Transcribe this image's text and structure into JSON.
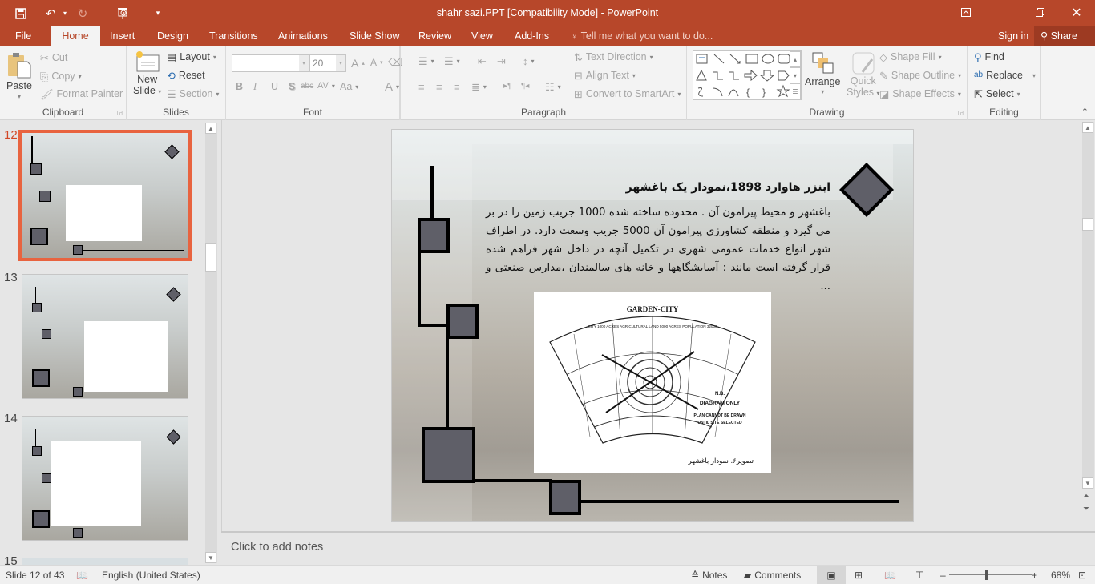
{
  "app": {
    "window_title": "shahr sazi.PPT [Compatibility Mode] - PowerPoint",
    "quick_access": [
      "save-icon",
      "undo-icon",
      "redo-icon",
      "start-from-beginning-icon",
      "customize-qat-icon"
    ],
    "window_controls": [
      "ribbon-display-options-icon",
      "minimize-icon",
      "restore-icon",
      "close-icon"
    ]
  },
  "tabs": [
    {
      "label": "File"
    },
    {
      "label": "Home",
      "active": true
    },
    {
      "label": "Insert"
    },
    {
      "label": "Design"
    },
    {
      "label": "Transitions"
    },
    {
      "label": "Animations"
    },
    {
      "label": "Slide Show"
    },
    {
      "label": "Review"
    },
    {
      "label": "View"
    },
    {
      "label": "Add-Ins"
    }
  ],
  "tell_me": "Tell me what you want to do...",
  "sign_in": "Sign in",
  "share": "Share",
  "ribbon": {
    "clipboard": {
      "label": "Clipboard",
      "paste": "Paste",
      "cut": "Cut",
      "copy": "Copy",
      "format_painter": "Format Painter"
    },
    "slides": {
      "label": "Slides",
      "new_slide_1": "New",
      "new_slide_2": "Slide",
      "layout": "Layout",
      "reset": "Reset",
      "section": "Section"
    },
    "font": {
      "label": "Font",
      "font_name": "",
      "font_size": "20",
      "bold": "B",
      "italic": "I",
      "underline": "U",
      "shadow": "S",
      "strike": "abc",
      "spacing": "AV",
      "case": "Aa",
      "color": "A",
      "grow": "A",
      "shrink": "A"
    },
    "paragraph": {
      "label": "Paragraph",
      "text_direction": "Text Direction",
      "align_text": "Align Text",
      "smartart": "Convert to SmartArt"
    },
    "drawing": {
      "label": "Drawing",
      "arrange": "Arrange",
      "quick_styles_1": "Quick",
      "quick_styles_2": "Styles",
      "shape_fill": "Shape Fill",
      "shape_outline": "Shape Outline",
      "shape_effects": "Shape Effects"
    },
    "editing": {
      "label": "Editing",
      "find": "Find",
      "replace": "Replace",
      "select": "Select"
    }
  },
  "thumbnails": [
    {
      "number": "12",
      "selected": true
    },
    {
      "number": "13",
      "selected": false
    },
    {
      "number": "14",
      "selected": false
    },
    {
      "number": "15",
      "selected": false
    }
  ],
  "slide": {
    "title": "ابنزر هاوارد 1898،نمودار یک  باغشهر",
    "body": "باغشهر و محیط پیرامون آن . محدوده ساخته شده 1000 جریب زمین را در بر می گیرد و منطقه کشاورزی پیرامون آن 5000 جریب وسعت دارد. در اطراف شهر انواع خدمات عمومی شهری در تکمیل آنچه در داخل شهر فراهم شده قرار گرفته است مانند : آسایشگاهها و خانه های سالمندان ،مدارس صنعتی و ...",
    "figure": {
      "heading": "GARDEN-CITY",
      "arc_label": "CITY 1000 ACRES   AGRICULTURAL LAND 5000 ACRES   POPULATION 32000",
      "note_1": "N.B.",
      "note_2": "DIAGRAM ONLY",
      "note_3": "PLAN CANNOT BE DRAWN",
      "note_4": "UNTIL SITE SELECTED",
      "caption": "تصویر۶. نمودار باغشهر"
    }
  },
  "notes_placeholder": "Click to add notes",
  "status": {
    "slide_info": "Slide 12 of 43",
    "language": "English (United States)",
    "notes": "Notes",
    "comments": "Comments",
    "zoom": "68%",
    "zoom_fraction": 0.45
  },
  "colors": {
    "accent": "#b7472a",
    "selected_thumb": "#e8633f",
    "shape_fill": "#5f5f68"
  }
}
